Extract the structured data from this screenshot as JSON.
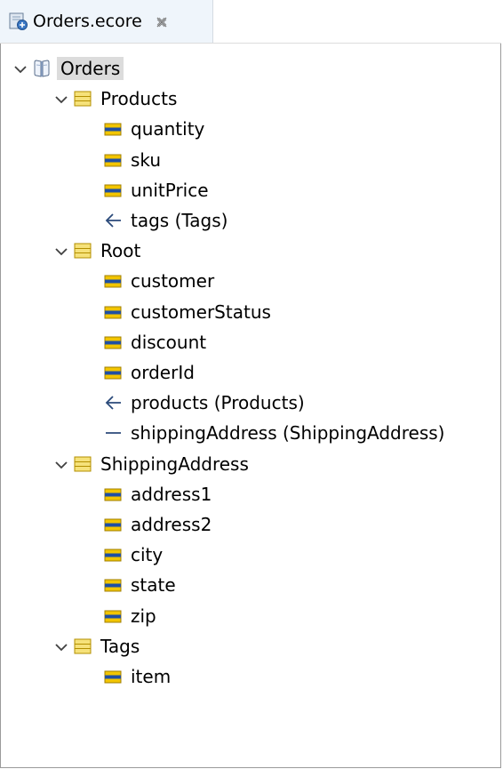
{
  "tab": {
    "title": "Orders.ecore",
    "icon": "ecore-model-file-icon",
    "close_icon": "close-icon"
  },
  "tree": {
    "root": {
      "label": "Orders",
      "icon": "package-icon"
    },
    "classes": [
      {
        "label": "Products",
        "children": [
          {
            "label": "quantity",
            "kind": "attribute"
          },
          {
            "label": "sku",
            "kind": "attribute"
          },
          {
            "label": "unitPrice",
            "kind": "attribute"
          },
          {
            "label": "tags (Tags)",
            "kind": "reference-many"
          }
        ]
      },
      {
        "label": "Root",
        "children": [
          {
            "label": "customer",
            "kind": "attribute"
          },
          {
            "label": "customerStatus",
            "kind": "attribute"
          },
          {
            "label": "discount",
            "kind": "attribute"
          },
          {
            "label": "orderId",
            "kind": "attribute"
          },
          {
            "label": "products (Products)",
            "kind": "reference-many"
          },
          {
            "label": "shippingAddress (ShippingAddress)",
            "kind": "reference-single"
          }
        ]
      },
      {
        "label": "ShippingAddress",
        "children": [
          {
            "label": "address1",
            "kind": "attribute"
          },
          {
            "label": "address2",
            "kind": "attribute"
          },
          {
            "label": "city",
            "kind": "attribute"
          },
          {
            "label": "state",
            "kind": "attribute"
          },
          {
            "label": "zip",
            "kind": "attribute"
          }
        ]
      },
      {
        "label": "Tags",
        "children": [
          {
            "label": "item",
            "kind": "attribute"
          }
        ]
      }
    ]
  },
  "colors": {
    "tab_bg": "#eff5fb",
    "selected_bg": "#dcdcdc",
    "class_icon_fill": "#f6e27a",
    "class_icon_stroke": "#b38f00",
    "attribute_icon_fill": "#f2c500",
    "attribute_icon_band": "#1f4fa3",
    "chevron": "#404040",
    "reference_stroke": "#2b4a7a"
  }
}
